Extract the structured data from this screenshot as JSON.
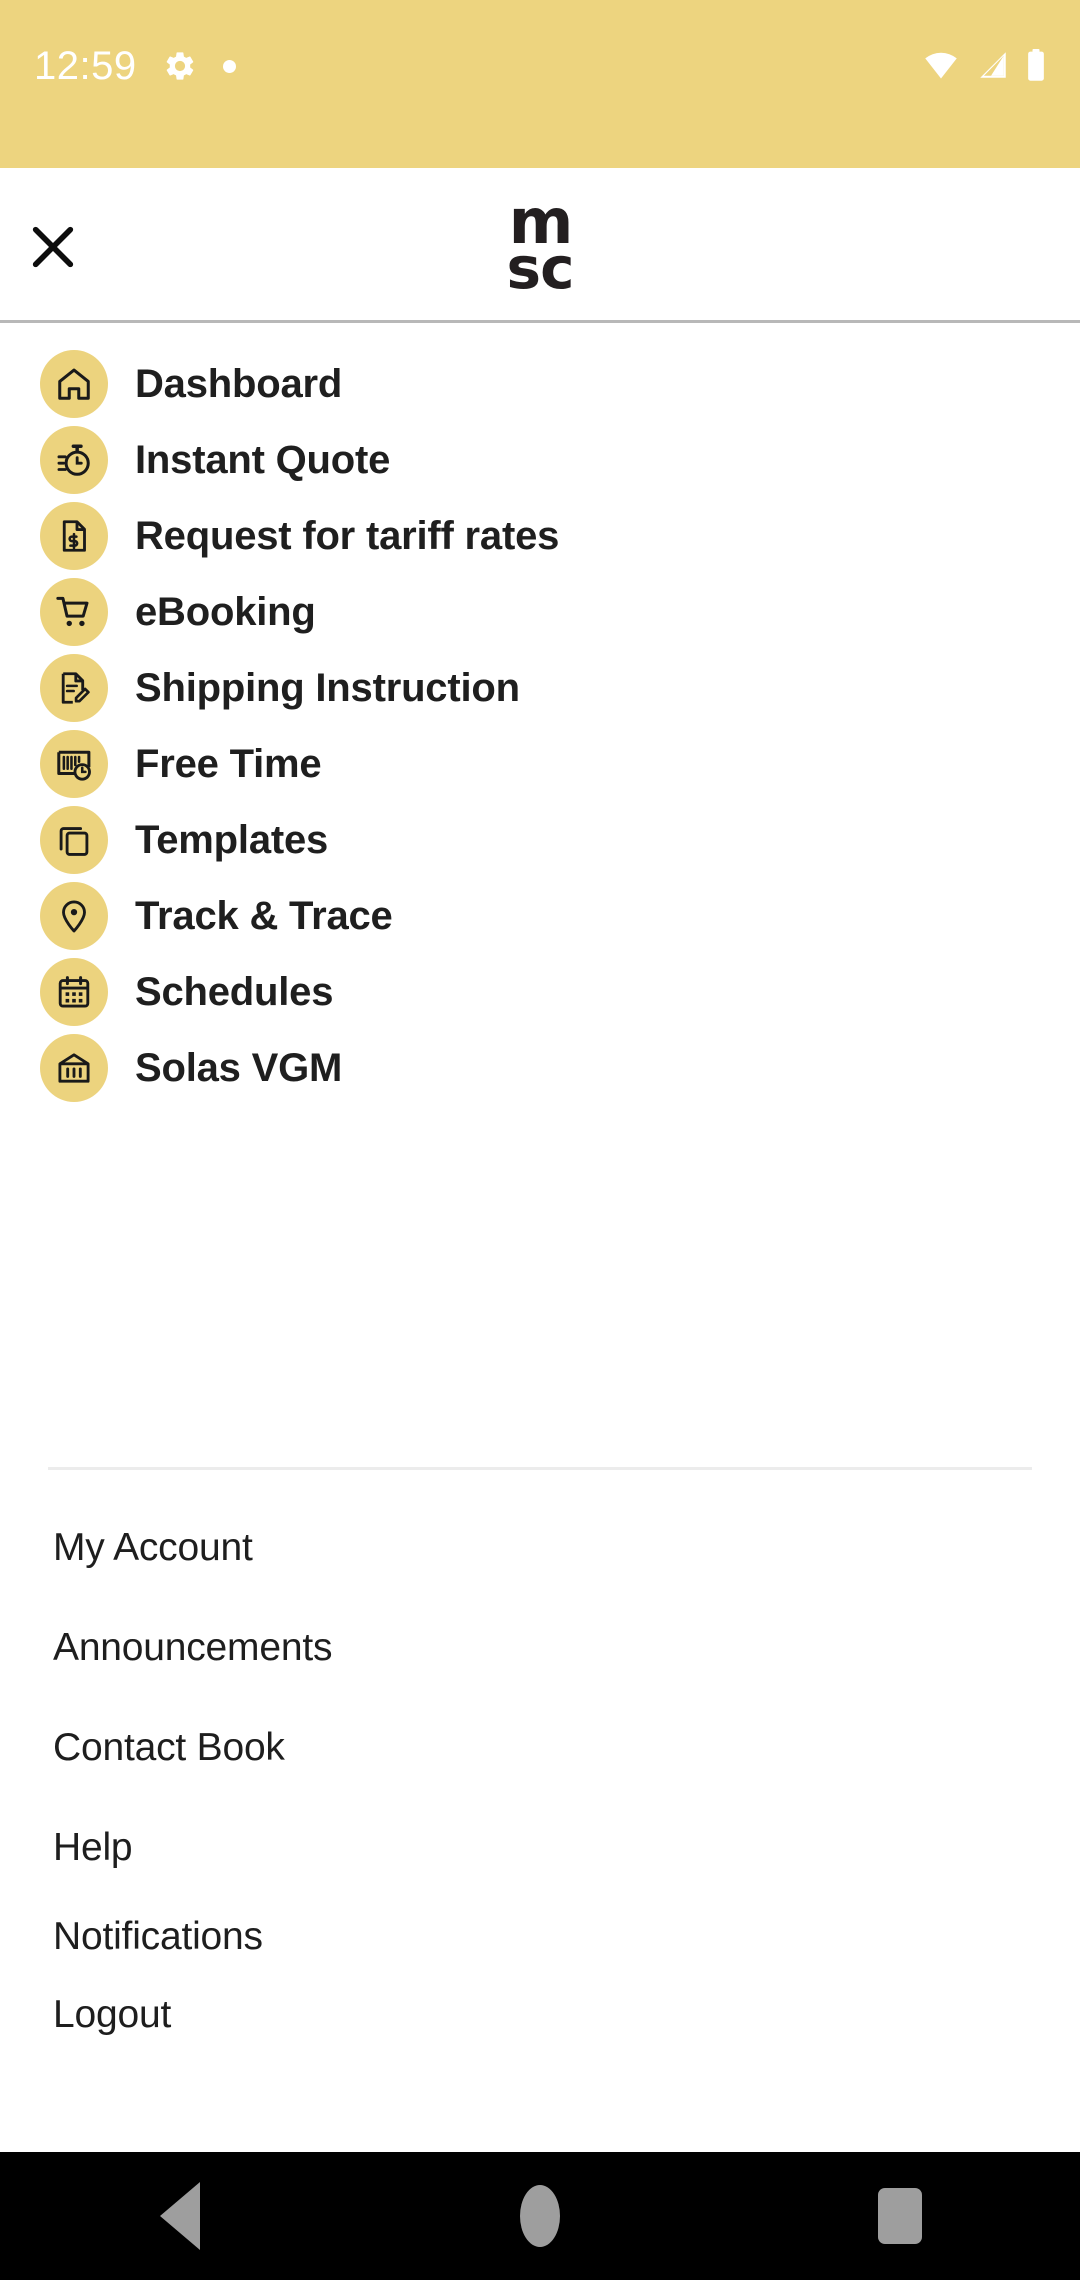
{
  "status_bar": {
    "time": "12:59",
    "icons": [
      "gear-icon",
      "dot-indicator",
      "wifi-icon",
      "cellular-signal-icon",
      "battery-icon"
    ],
    "background_color": "#edd47f",
    "text_color": "#ffffff"
  },
  "header": {
    "close_label": "✕",
    "close_icon": "close-icon",
    "logo_top": "m",
    "logo_bottom": "sc",
    "logo_name": "msc-logo"
  },
  "theme": {
    "accent": "#edd47f",
    "icon_circle": "#ecd37e",
    "text": "#1f1f1f",
    "divider": "#ececec",
    "header_border": "#b8b8b8",
    "navbar_background": "#000000",
    "navbar_icon": "#9e9e9e"
  },
  "primary_menu": {
    "items": [
      {
        "label": "Dashboard",
        "icon": "home-icon"
      },
      {
        "label": "Instant Quote",
        "icon": "stopwatch-icon"
      },
      {
        "label": "Request for tariff rates",
        "icon": "document-dollar-icon"
      },
      {
        "label": "eBooking",
        "icon": "shopping-cart-icon"
      },
      {
        "label": "Shipping Instruction",
        "icon": "document-edit-icon"
      },
      {
        "label": "Free Time",
        "icon": "barcode-clock-icon"
      },
      {
        "label": "Templates",
        "icon": "copy-icon"
      },
      {
        "label": "Track & Trace",
        "icon": "location-pin-icon"
      },
      {
        "label": "Schedules",
        "icon": "calendar-icon"
      },
      {
        "label": "Solas VGM",
        "icon": "container-weight-icon"
      }
    ]
  },
  "secondary_menu": {
    "items": [
      {
        "label": "My Account"
      },
      {
        "label": "Announcements"
      },
      {
        "label": "Contact Book"
      },
      {
        "label": "Help"
      },
      {
        "label": "Notifications"
      },
      {
        "label": "Logout"
      }
    ]
  },
  "nav_bar": {
    "back": "back-button",
    "home": "home-button",
    "recents": "recents-button"
  }
}
